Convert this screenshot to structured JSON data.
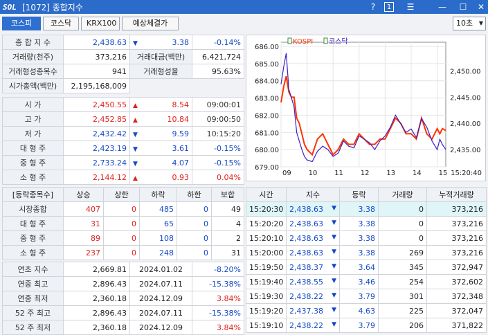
{
  "window": {
    "logo": "SOL",
    "title": "[1072] 종합지수",
    "help": "?",
    "one": "1",
    "menu": "☰",
    "min": "—",
    "max": "☐",
    "close": "✕"
  },
  "tabs": [
    {
      "label": "코스피"
    },
    {
      "label": "코스닥"
    },
    {
      "label": "KRX100"
    },
    {
      "label": "예상체결가"
    }
  ],
  "interval": "10초",
  "summary": {
    "index_label": "종 합 지 수",
    "index": "2,438.63",
    "index_arrow": "▼",
    "index_change": "3.38",
    "index_rate": "-0.14%",
    "volume_label": "거래량(천주)",
    "volume": "373,216",
    "amount_label": "거래대금(백만)",
    "amount": "6,421,724",
    "formed_label": "거래형성종목수",
    "formed": "941",
    "formed_rate_label": "거래형성율",
    "formed_rate": "95.63%",
    "mktcap_label": "시가총액(백만)",
    "mktcap": "2,195,168,009"
  },
  "prices": [
    {
      "label": "시      가",
      "value": "2,450.55",
      "arrow": "▲",
      "change": "8.54",
      "extra": "09:00:01",
      "color": "red"
    },
    {
      "label": "고      가",
      "value": "2,452.85",
      "arrow": "▲",
      "change": "10.84",
      "extra": "09:00:50",
      "color": "red"
    },
    {
      "label": "저      가",
      "value": "2,432.42",
      "arrow": "▼",
      "change": "9.59",
      "extra": "10:15:20",
      "color": "blue"
    },
    {
      "label": "대 형 주",
      "value": "2,423.19",
      "arrow": "▼",
      "change": "3.61",
      "extra": "-0.15%",
      "color": "blue"
    },
    {
      "label": "중 형 주",
      "value": "2,733.24",
      "arrow": "▼",
      "change": "4.07",
      "extra": "-0.15%",
      "color": "blue"
    },
    {
      "label": "소 형 주",
      "value": "2,144.12",
      "arrow": "▲",
      "change": "0.93",
      "extra": "0.04%",
      "color": "red"
    }
  ],
  "updown": {
    "headers": [
      "[등락종목수]",
      "상승",
      "상한",
      "하락",
      "하한",
      "보합"
    ],
    "rows": [
      {
        "label": "시장종합",
        "up": "407",
        "upper": "0",
        "down": "485",
        "lower": "0",
        "flat": "49"
      },
      {
        "label": "대 형 주",
        "up": "31",
        "upper": "0",
        "down": "65",
        "lower": "0",
        "flat": "4"
      },
      {
        "label": "중 형 주",
        "up": "89",
        "upper": "0",
        "down": "108",
        "lower": "0",
        "flat": "2"
      },
      {
        "label": "소 형 주",
        "up": "237",
        "upper": "0",
        "down": "248",
        "lower": "0",
        "flat": "31"
      }
    ]
  },
  "yearly": [
    {
      "label": "연초  지수",
      "value": "2,669.81",
      "date": "2024.01.02",
      "rate": "-8.20%",
      "color": "blue"
    },
    {
      "label": "연중  최고",
      "value": "2,896.43",
      "date": "2024.07.11",
      "rate": "-15.38%",
      "color": "blue"
    },
    {
      "label": "연중  최저",
      "value": "2,360.18",
      "date": "2024.12.09",
      "rate": "3.84%",
      "color": "red"
    },
    {
      "label": "52 주 최고",
      "value": "2,896.43",
      "date": "2024.07.11",
      "rate": "-15.38%",
      "color": "blue"
    },
    {
      "label": "52 주 최저",
      "value": "2,360.18",
      "date": "2024.12.09",
      "rate": "3.84%",
      "color": "red"
    }
  ],
  "ticks": {
    "headers": [
      "시간",
      "지수",
      "등락",
      "거래량",
      "누적거래량"
    ],
    "rows": [
      {
        "time": "15:20:30",
        "index": "2,438.63",
        "arrow": "▼",
        "change": "3.38",
        "vol": "0",
        "cum": "373,216"
      },
      {
        "time": "15:20:20",
        "index": "2,438.63",
        "arrow": "▼",
        "change": "3.38",
        "vol": "0",
        "cum": "373,216"
      },
      {
        "time": "15:20:10",
        "index": "2,438.63",
        "arrow": "▼",
        "change": "3.38",
        "vol": "0",
        "cum": "373,216"
      },
      {
        "time": "15:20:00",
        "index": "2,438.63",
        "arrow": "▼",
        "change": "3.38",
        "vol": "269",
        "cum": "373,216"
      },
      {
        "time": "15:19:50",
        "index": "2,438.37",
        "arrow": "▼",
        "change": "3.64",
        "vol": "345",
        "cum": "372,947"
      },
      {
        "time": "15:19:40",
        "index": "2,438.55",
        "arrow": "▼",
        "change": "3.46",
        "vol": "254",
        "cum": "372,602"
      },
      {
        "time": "15:19:30",
        "index": "2,438.22",
        "arrow": "▼",
        "change": "3.79",
        "vol": "301",
        "cum": "372,348"
      },
      {
        "time": "15:19:20",
        "index": "2,437.38",
        "arrow": "▼",
        "change": "4.63",
        "vol": "225",
        "cum": "372,047"
      },
      {
        "time": "15:19:10",
        "index": "2,438.22",
        "arrow": "▼",
        "change": "3.79",
        "vol": "206",
        "cum": "371,822"
      }
    ]
  },
  "chart_data": {
    "type": "line",
    "series": [
      {
        "name": "KOSPI",
        "color": "#ff3300",
        "axis": "right",
        "x": [
          9,
          9.1,
          9.2,
          9.3,
          9.4,
          9.5,
          9.6,
          9.7,
          9.8,
          9.9,
          10,
          10.2,
          10.4,
          10.6,
          10.8,
          11,
          11.2,
          11.4,
          11.6,
          11.8,
          12,
          12.2,
          12.4,
          12.6,
          12.8,
          13,
          13.2,
          13.4,
          13.6,
          13.8,
          14,
          14.2,
          14.4,
          14.6,
          14.8,
          15,
          15.1,
          15.2,
          15.33
        ],
        "values": [
          2444,
          2447,
          2449,
          2446,
          2445,
          2445,
          2441,
          2440,
          2438,
          2436,
          2435,
          2434,
          2437,
          2438,
          2436,
          2434,
          2435,
          2437,
          2436,
          2436,
          2438,
          2437,
          2436,
          2436,
          2437,
          2437,
          2439,
          2441,
          2440,
          2438,
          2438,
          2437,
          2441,
          2438,
          2437,
          2439,
          2438,
          2439,
          2438.63
        ]
      },
      {
        "name": "코스닥",
        "color": "#3a1fc9",
        "axis": "left",
        "x": [
          9,
          9.1,
          9.2,
          9.3,
          9.4,
          9.5,
          9.6,
          9.7,
          9.8,
          9.9,
          10,
          10.2,
          10.4,
          10.6,
          10.8,
          11,
          11.2,
          11.4,
          11.6,
          11.8,
          12,
          12.2,
          12.4,
          12.6,
          12.8,
          13,
          13.2,
          13.4,
          13.6,
          13.8,
          14,
          14.2,
          14.4,
          14.6,
          14.8,
          15,
          15.1,
          15.2,
          15.33
        ],
        "values": [
          683.8,
          684.8,
          685.6,
          683.5,
          683.0,
          682.5,
          681.0,
          680.5,
          680.0,
          679.6,
          679.4,
          679.3,
          679.9,
          680.2,
          680.0,
          679.6,
          679.8,
          680.5,
          680.2,
          680.1,
          680.8,
          680.6,
          680.4,
          680.0,
          680.5,
          680.8,
          681.3,
          682.0,
          681.5,
          681.0,
          681.2,
          680.7,
          681.8,
          681.3,
          680.5,
          680.0,
          680.6,
          680.3,
          680.0
        ]
      }
    ],
    "x_ticks": [
      "09",
      "10",
      "11",
      "12",
      "13",
      "14",
      "15"
    ],
    "x_tick_values": [
      9,
      10,
      11,
      12,
      13,
      14,
      15
    ],
    "x_range": [
      9,
      15.33
    ],
    "y_left_ticks": [
      "686.00",
      "685.00",
      "684.00",
      "683.00",
      "682.00",
      "681.00",
      "680.00",
      "679.00"
    ],
    "y_left_range": [
      679,
      686
    ],
    "y_right_ticks": [
      "2,450.00",
      "2,445.00",
      "2,440.00",
      "2,435.00"
    ],
    "y_right_range": [
      2431.7,
      2454.7
    ],
    "time_label": "15:20:40",
    "grid": true,
    "legend": "top-left"
  }
}
